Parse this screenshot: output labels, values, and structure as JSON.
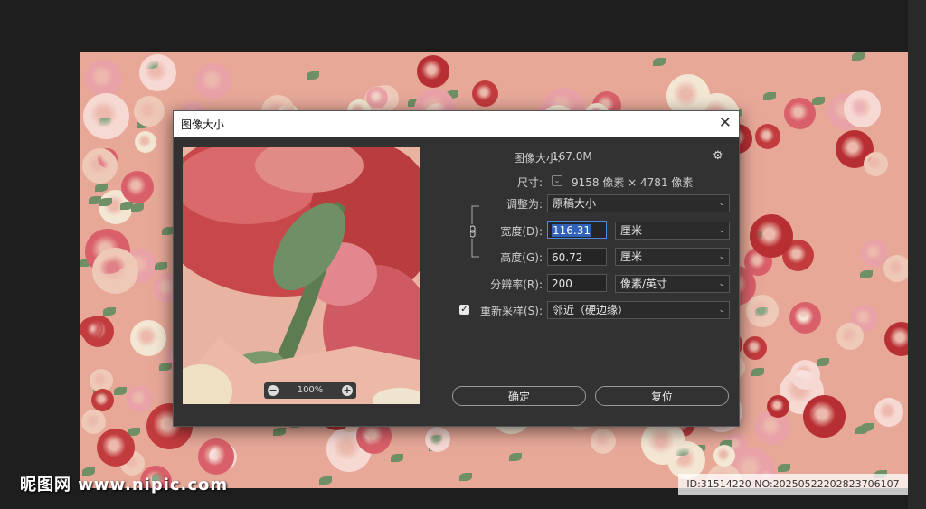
{
  "dialog": {
    "title": "图像大小",
    "close_glyph": "✕",
    "image_size_label": "图像大小:",
    "image_size_value": "167.0M",
    "gear_glyph": "⚙",
    "dimensions_label": "尺寸:",
    "dimensions_value": "9158 像素  ×  4781 像素",
    "fit_label": "调整为:",
    "fit_value": "原稿大小",
    "width_label": "宽度(D):",
    "width_value": "116.31",
    "width_unit": "厘米",
    "height_label": "高度(G):",
    "height_value": "60.72",
    "height_unit": "厘米",
    "resolution_label": "分辨率(R):",
    "resolution_value": "200",
    "resolution_unit": "像素/英寸",
    "resample_label": "重新采样(S):",
    "resample_checked": true,
    "resample_value": "邻近（硬边缘）",
    "ok_label": "确定",
    "reset_label": "复位",
    "zoom_value": "100%",
    "zoom_minus": "−",
    "zoom_plus": "+"
  },
  "watermark": {
    "left_text": "昵图网 www.nipic.com",
    "right_text": "ID:31514220 NO:20250522202823706107"
  },
  "colors": {
    "dialog_bg": "#323232",
    "canvas_bg": "#e7a898",
    "accent": "#4d8be5"
  },
  "icons": [
    "close-icon",
    "gear-icon",
    "chain-link-icon",
    "chevron-down-icon",
    "zoom-out-icon",
    "zoom-in-icon",
    "checkbox-icon"
  ]
}
